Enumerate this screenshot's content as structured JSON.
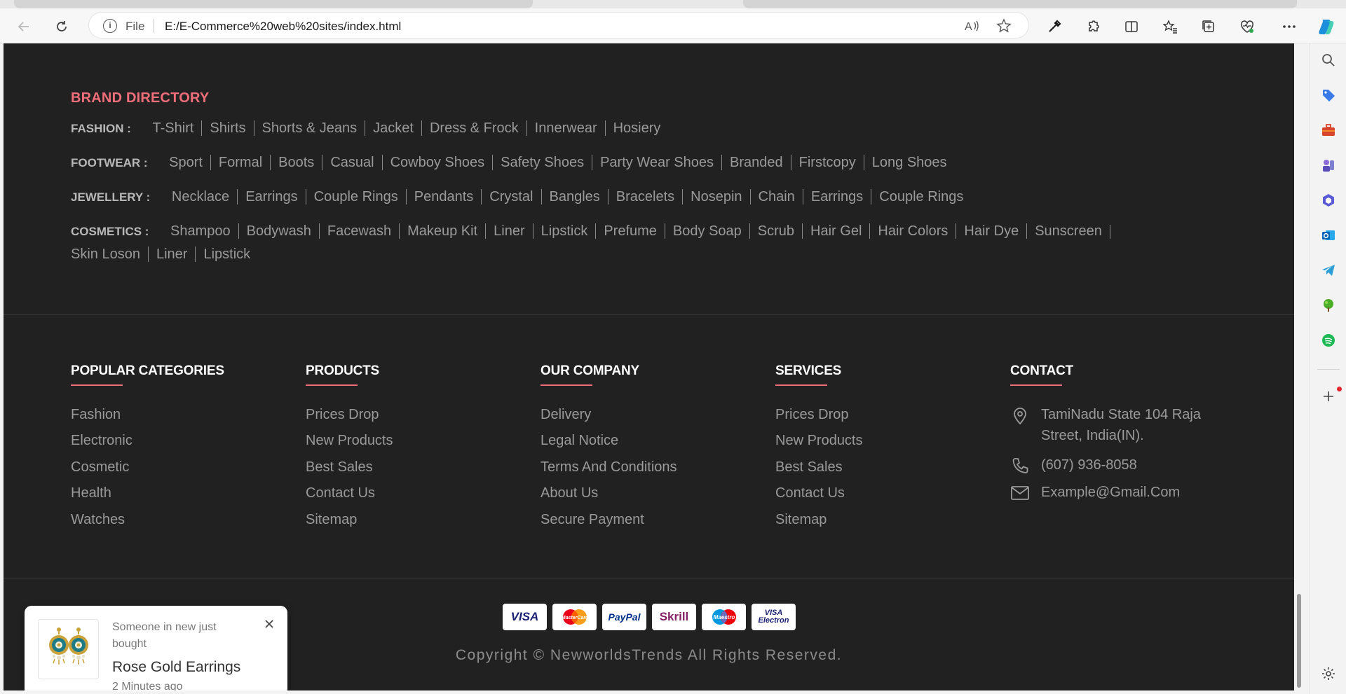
{
  "browser": {
    "scheme": "File",
    "url": "E:/E-Commerce%20web%20sites/index.html"
  },
  "brand_directory": {
    "title": "BRAND DIRECTORY",
    "rows": [
      {
        "category": "FASHION :",
        "links": [
          "T-Shirt",
          "Shirts",
          "Shorts & Jeans",
          "Jacket",
          "Dress & Frock",
          "Innerwear",
          "Hosiery"
        ]
      },
      {
        "category": "FOOTWEAR :",
        "links": [
          "Sport",
          "Formal",
          "Boots",
          "Casual",
          "Cowboy Shoes",
          "Safety Shoes",
          "Party Wear Shoes",
          "Branded",
          "Firstcopy",
          "Long Shoes"
        ]
      },
      {
        "category": "JEWELLERY :",
        "links": [
          "Necklace",
          "Earrings",
          "Couple Rings",
          "Pendants",
          "Crystal",
          "Bangles",
          "Bracelets",
          "Nosepin",
          "Chain",
          "Earrings",
          "Couple Rings"
        ]
      },
      {
        "category": "COSMETICS :",
        "links": [
          "Shampoo",
          "Bodywash",
          "Facewash",
          "Makeup Kit",
          "Liner",
          "Lipstick",
          "Prefume",
          "Body Soap",
          "Scrub",
          "Hair Gel",
          "Hair Colors",
          "Hair Dye",
          "Sunscreen",
          "Skin Loson",
          "Liner",
          "Lipstick"
        ]
      }
    ]
  },
  "footer": {
    "columns": [
      {
        "title": "POPULAR CATEGORIES",
        "items": [
          "Fashion",
          "Electronic",
          "Cosmetic",
          "Health",
          "Watches"
        ]
      },
      {
        "title": "PRODUCTS",
        "items": [
          "Prices Drop",
          "New Products",
          "Best Sales",
          "Contact Us",
          "Sitemap"
        ]
      },
      {
        "title": "OUR COMPANY",
        "items": [
          "Delivery",
          "Legal Notice",
          "Terms And Conditions",
          "About Us",
          "Secure Payment"
        ]
      },
      {
        "title": "SERVICES",
        "items": [
          "Prices Drop",
          "New Products",
          "Best Sales",
          "Contact Us",
          "Sitemap"
        ]
      }
    ],
    "contact": {
      "title": "CONTACT",
      "address": "TamiNadu State 104 Raja Street, India(IN).",
      "phone": "(607) 936-8058",
      "email": "Example@Gmail.Com"
    },
    "payments": [
      "VISA",
      "MasterCard",
      "PayPal",
      "Skrill",
      "Maestro",
      "VISA Electron"
    ],
    "copyright": "Copyright © NewworldsTrends All Rights Reserved."
  },
  "popup": {
    "notice": "Someone in new just bought",
    "product": "Rose Gold Earrings",
    "time": "2 Minutes ago"
  },
  "colors": {
    "page_bg": "#212121",
    "accent": "#f06e7a",
    "text_muted": "#9a9a9a"
  }
}
